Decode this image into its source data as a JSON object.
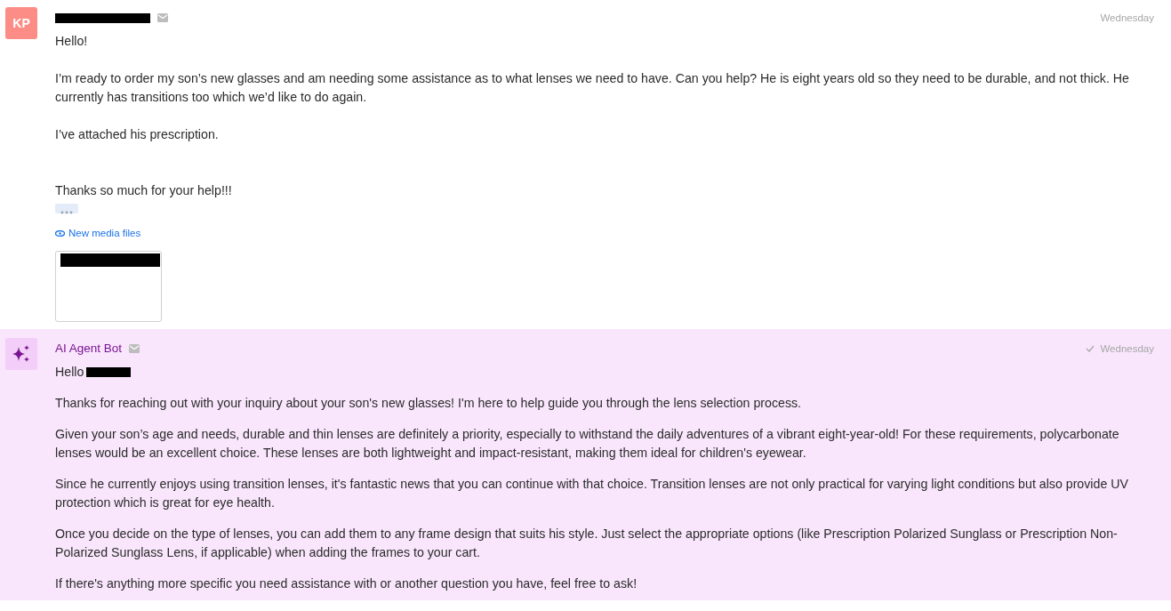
{
  "messages": [
    {
      "kind": "customer",
      "avatar": "KP",
      "sender_redacted": true,
      "date": "Wednesday",
      "delivered": false,
      "paragraphs": [
        "Hello!",
        "I’m ready to order my son’s new glasses and am needing some assistance as to what lenses we need to have. Can you help? He is eight years old so they need to be durable, and not thick. He currently has transitions too which we’d like to do again.",
        "I’ve attached his prescription.",
        "Thanks so much for your help!!!"
      ],
      "media_link": "New media files"
    },
    {
      "kind": "bot",
      "sender": "AI Agent Bot",
      "date": "Wednesday",
      "delivered": true,
      "greeting": "Hello",
      "paragraphs": [
        "Thanks for reaching out with your inquiry about your son's new glasses! I'm here to help guide you through the lens selection process.",
        "Given your son’s age and needs, durable and thin lenses are definitely a priority, especially to withstand the daily adventures of a vibrant eight-year-old! For these requirements, polycarbonate lenses would be an excellent choice. These lenses are both lightweight and impact-resistant, making them ideal for children's eyewear.",
        "Since he currently enjoys using transition lenses, it's fantastic news that you can continue with that choice. Transition lenses are not only practical for varying light conditions but also provide UV protection which is great for eye health.",
        "Once you decide on the type of lenses, you can add them to any frame design that suits his style. Just select the appropriate options (like Prescription Polarized Sunglass or Prescription Non-Polarized Sunglass Lens, if applicable) when adding the frames to your cart.",
        "If there's anything more specific you need assistance with or another question you have, feel free to ask!"
      ]
    }
  ]
}
